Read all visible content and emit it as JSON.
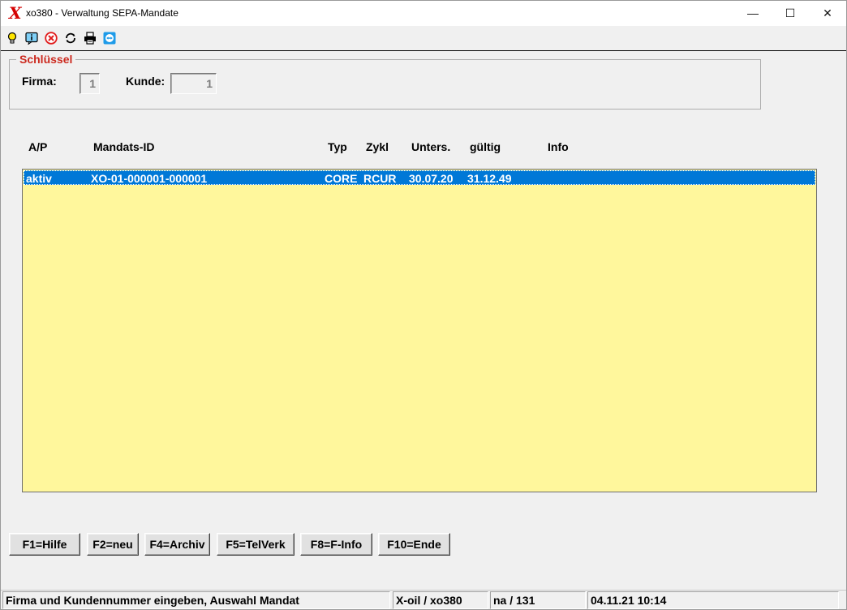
{
  "window": {
    "title": "xo380 - Verwaltung SEPA-Mandate",
    "logo_glyph": "X",
    "minimize_glyph": "—",
    "maximize_glyph": "☐",
    "close_glyph": "✕"
  },
  "toolbar": {
    "icons": [
      "lightbulb-icon",
      "info-icon",
      "cancel-icon",
      "refresh-icon",
      "printer-icon",
      "remote-support-icon"
    ]
  },
  "key_group": {
    "legend": "Schlüssel",
    "firma_label": "Firma:",
    "firma_value": "1",
    "kunde_label": "Kunde:",
    "kunde_value": "1"
  },
  "list": {
    "columns": [
      "A/P",
      "Mandats-ID",
      "Typ",
      "Zykl",
      "Unters.",
      "gültig",
      "Info"
    ],
    "rows": [
      {
        "ap": "aktiv",
        "mandats_id": "XO-01-000001-000001",
        "typ": "CORE",
        "zykl": "RCUR",
        "unters": "30.07.20",
        "gueltig": "31.12.49",
        "info": ""
      }
    ],
    "background_color": "#fff79c",
    "selection_color": "#0078d7"
  },
  "buttons": {
    "f1": "F1=Hilfe",
    "f2": "F2=neu",
    "f4": "F4=Archiv",
    "f5": "F5=TelVerk",
    "f8": "F8=F-Info",
    "f10": "F10=Ende"
  },
  "status": {
    "message": "Firma und Kundennummer eingeben, Auswahl Mandat",
    "program": "X-oil / xo380",
    "user": "na / 131",
    "datetime": "04.11.21 10:14"
  },
  "colors": {
    "legend_red": "#cc2a1f",
    "logo_red": "#d40000"
  }
}
